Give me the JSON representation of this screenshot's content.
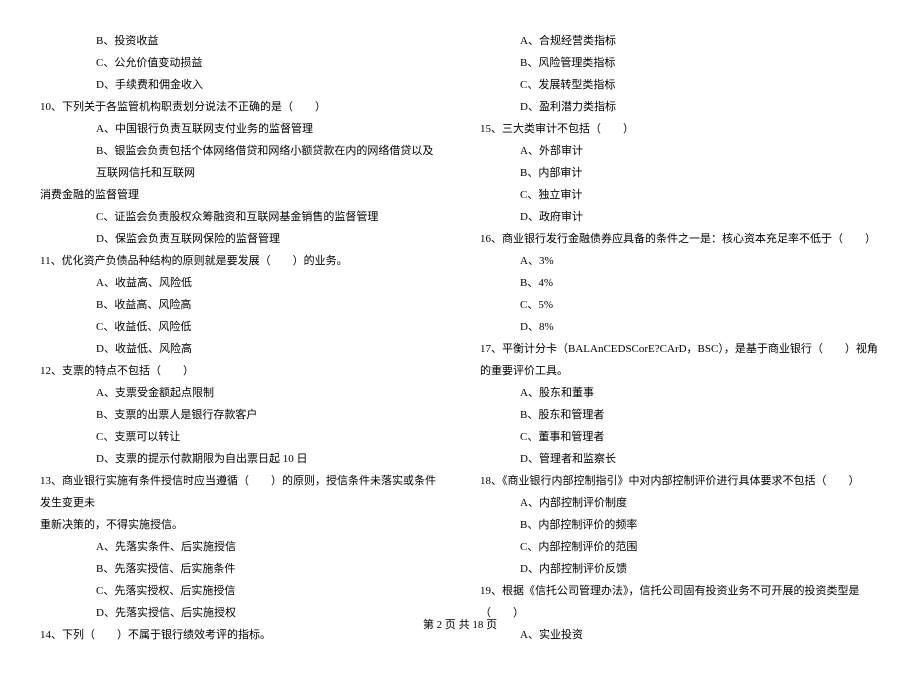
{
  "left": {
    "pre_opts": [
      "B、投资收益",
      "C、公允价值变动损益",
      "D、手续费和佣金收入"
    ],
    "q10": "10、下列关于各监管机构职责划分说法不正确的是（　　）",
    "q10_opts": [
      "A、中国银行负责互联网支付业务的监督管理",
      "B、银监会负责包括个体网络借贷和网络小额贷款在内的网络借贷以及互联网信托和互联网"
    ],
    "q10_cont": "消费金融的监督管理",
    "q10_opts2": [
      "C、证监会负责股权众筹融资和互联网基金销售的监督管理",
      "D、保监会负责互联网保险的监督管理"
    ],
    "q11": "11、优化资产负债品种结构的原则就是要发展（　　）的业务。",
    "q11_opts": [
      "A、收益高、风险低",
      "B、收益高、风险高",
      "C、收益低、风险低",
      "D、收益低、风险高"
    ],
    "q12": "12、支票的特点不包括（　　）",
    "q12_opts": [
      "A、支票受金额起点限制",
      "B、支票的出票人是银行存款客户",
      "C、支票可以转让",
      "D、支票的提示付款期限为自出票日起 10 日"
    ],
    "q13": "13、商业银行实施有条件授信时应当遵循（　　）的原则，授信条件未落实或条件发生变更未",
    "q13_cont": "重新决策的，不得实施授信。",
    "q13_opts": [
      "A、先落实条件、后实施授信",
      "B、先落实授信、后实施条件",
      "C、先落实授权、后实施授信",
      "D、先落实授信、后实施授权"
    ],
    "q14": "14、下列（　　）不属于银行绩效考评的指标。"
  },
  "right": {
    "q14_opts": [
      "A、合规经营类指标",
      "B、风险管理类指标",
      "C、发展转型类指标",
      "D、盈利潜力类指标"
    ],
    "q15": "15、三大类审计不包括（　　）",
    "q15_opts": [
      "A、外部审计",
      "B、内部审计",
      "C、独立审计",
      "D、政府审计"
    ],
    "q16": "16、商业银行发行金融债券应具备的条件之一是：核心资本充足率不低于（　　）",
    "q16_opts": [
      "A、3%",
      "B、4%",
      "C、5%",
      "D、8%"
    ],
    "q17": "17、平衡计分卡（BALAnCEDSCorE?CArD，BSC），是基于商业银行（　　）视角的重要评价工具。",
    "q17_opts": [
      "A、股东和董事",
      "B、股东和管理者",
      "C、董事和管理者",
      "D、管理者和监察长"
    ],
    "q18": "18、《商业银行内部控制指引》中对内部控制评价进行具体要求不包括（　　）",
    "q18_opts": [
      "A、内部控制评价制度",
      "B、内部控制评价的频率",
      "C、内部控制评价的范围",
      "D、内部控制评价反馈"
    ],
    "q19": "19、根据《信托公司管理办法》，信托公司固有投资业务不可开展的投资类型是（　　）",
    "q19_opts": [
      "A、实业投资"
    ]
  },
  "footer": "第 2 页 共 18 页"
}
